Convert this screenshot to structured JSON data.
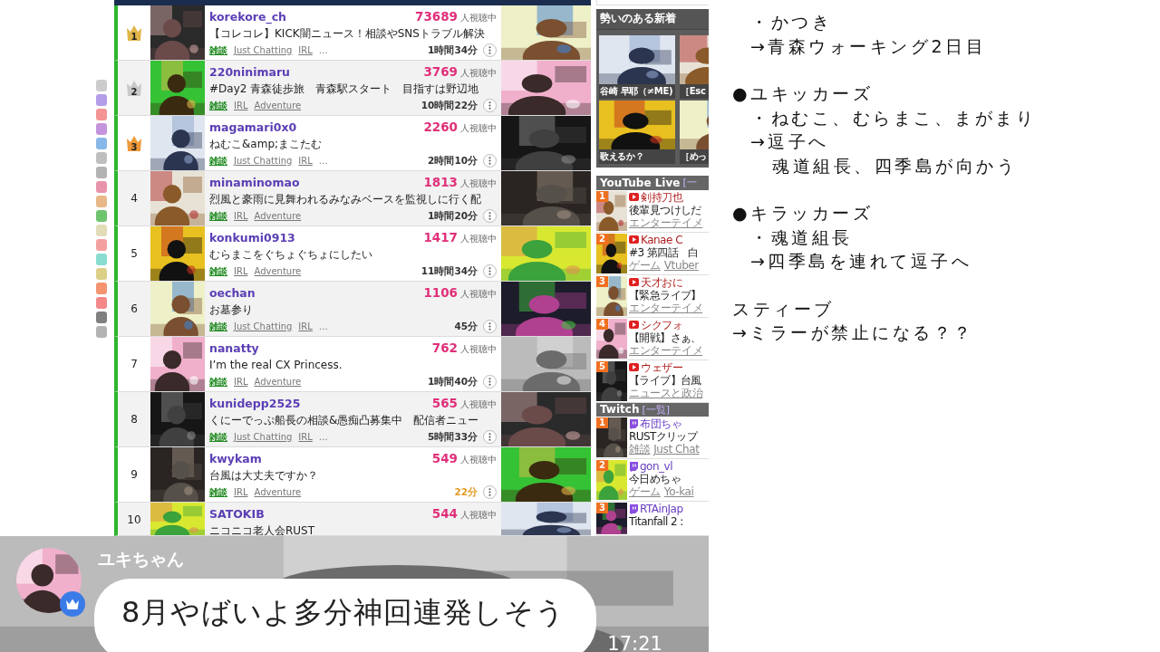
{
  "ranking": {
    "rows": [
      {
        "rank": "1",
        "kind": "crown",
        "color": "#e2b54a",
        "name": "korekore_ch",
        "viewers": "73689",
        "viewers_label": "人視聴中",
        "title": "【コレコレ】KICK闇ニュース！相談やSNSトラブル解決",
        "tags": [
          {
            "label": "雑談",
            "kind": "genre"
          },
          {
            "label": "Just Chatting",
            "kind": "link"
          },
          {
            "label": "IRL",
            "kind": "link"
          },
          {
            "label": "…",
            "kind": "more"
          }
        ],
        "duration": "1時間34分",
        "recent": false
      },
      {
        "rank": "2",
        "kind": "crown",
        "color": "#c9c9c9",
        "name": "220ninimaru",
        "viewers": "3769",
        "viewers_label": "人視聴中",
        "title": "#Day2 青森徒歩旅　青森駅スタート　目指すは野辺地",
        "tags": [
          {
            "label": "雑談",
            "kind": "genre"
          },
          {
            "label": "IRL",
            "kind": "link"
          },
          {
            "label": "Adventure",
            "kind": "link"
          }
        ],
        "duration": "10時間22分",
        "recent": false
      },
      {
        "rank": "3",
        "kind": "crown",
        "color": "#ee9a3a",
        "name": "magamari0x0",
        "viewers": "2260",
        "viewers_label": "人視聴中",
        "title": "ねむこ&amp;まこたむ",
        "tags": [
          {
            "label": "雑談",
            "kind": "genre"
          },
          {
            "label": "Just Chatting",
            "kind": "link"
          },
          {
            "label": "IRL",
            "kind": "link"
          },
          {
            "label": "…",
            "kind": "more"
          }
        ],
        "duration": "2時間10分",
        "recent": false
      },
      {
        "rank": "4",
        "kind": "number",
        "name": "minaminomao",
        "viewers": "1813",
        "viewers_label": "人視聴中",
        "title": "烈風と豪雨に見舞われるみなみベースを監視しに行く配",
        "tags": [
          {
            "label": "雑談",
            "kind": "genre"
          },
          {
            "label": "IRL",
            "kind": "link"
          },
          {
            "label": "Adventure",
            "kind": "link"
          }
        ],
        "duration": "1時間20分",
        "recent": false
      },
      {
        "rank": "5",
        "kind": "number",
        "name": "konkumi0913",
        "viewers": "1417",
        "viewers_label": "人視聴中",
        "title": "むらまこをぐちょぐちょにしたい",
        "tags": [
          {
            "label": "雑談",
            "kind": "genre"
          },
          {
            "label": "IRL",
            "kind": "link"
          },
          {
            "label": "Adventure",
            "kind": "link"
          }
        ],
        "duration": "11時間34分",
        "recent": false
      },
      {
        "rank": "6",
        "kind": "number",
        "name": "oechan",
        "viewers": "1106",
        "viewers_label": "人視聴中",
        "title": "お墓参り",
        "tags": [
          {
            "label": "雑談",
            "kind": "genre"
          },
          {
            "label": "Just Chatting",
            "kind": "link"
          },
          {
            "label": "IRL",
            "kind": "link"
          },
          {
            "label": "…",
            "kind": "more"
          }
        ],
        "duration": "45分",
        "recent": false
      },
      {
        "rank": "7",
        "kind": "number",
        "name": "nanatty",
        "viewers": "762",
        "viewers_label": "人視聴中",
        "title": "I’m the real CX Princess.",
        "tags": [
          {
            "label": "雑談",
            "kind": "genre"
          },
          {
            "label": "IRL",
            "kind": "link"
          },
          {
            "label": "Adventure",
            "kind": "link"
          }
        ],
        "duration": "1時間40分",
        "recent": false
      },
      {
        "rank": "8",
        "kind": "number",
        "name": "kunidepp2525",
        "viewers": "565",
        "viewers_label": "人視聴中",
        "title": "くにーでっぷ船長の相談&愚痴凸募集中　配信者ニュー",
        "tags": [
          {
            "label": "雑談",
            "kind": "genre"
          },
          {
            "label": "Just Chatting",
            "kind": "link"
          },
          {
            "label": "IRL",
            "kind": "link"
          },
          {
            "label": "…",
            "kind": "more"
          }
        ],
        "duration": "5時間33分",
        "recent": false
      },
      {
        "rank": "9",
        "kind": "number",
        "name": "kwykam",
        "viewers": "549",
        "viewers_label": "人視聴中",
        "title": "台風は大丈夫ですか？",
        "tags": [
          {
            "label": "雑談",
            "kind": "genre"
          },
          {
            "label": "IRL",
            "kind": "link"
          },
          {
            "label": "Adventure",
            "kind": "link"
          }
        ],
        "duration": "22分",
        "recent": true
      },
      {
        "rank": "10",
        "kind": "number",
        "name": "SATOKIB",
        "viewers": "544",
        "viewers_label": "人視聴中",
        "title": "ニコニコ老人会RUST"
      }
    ]
  },
  "sidebar": {
    "trending": {
      "title": "勢いのある新着",
      "items": [
        {
          "caption": "谷崎 早耶（≠ME)"
        },
        {
          "caption": "［Esc"
        },
        {
          "caption": "歌えるか？"
        },
        {
          "caption": "［めっ"
        }
      ]
    },
    "youtube": {
      "title": "YouTube Live",
      "link": "[一",
      "items": [
        {
          "rank": "1",
          "title": "剣持刀也",
          "description": "後輩見つけしだ",
          "categories": [
            "エンターテイメ"
          ]
        },
        {
          "rank": "2",
          "title": "Kanae C",
          "description": "#3 第四話　白",
          "categories": [
            "ゲーム",
            "Vtuber"
          ]
        },
        {
          "rank": "3",
          "title": "天才おに",
          "description": "【緊急ライブ】",
          "categories": [
            "エンターテイメ"
          ]
        },
        {
          "rank": "4",
          "title": "シクフォ",
          "description": "【開戦】さぁ、",
          "categories": [
            "エンターテイメ"
          ]
        },
        {
          "rank": "5",
          "title": "ウェザー",
          "description": "【ライブ】台風",
          "categories": [
            "ニュースと政治"
          ]
        }
      ]
    },
    "twitch": {
      "title": "Twitch",
      "link": "[一覧]",
      "items": [
        {
          "rank": "1",
          "title": "布団ちゃ",
          "description": "RUSTクリップ",
          "categories": [
            "雑談",
            "Just Chat"
          ]
        },
        {
          "rank": "2",
          "title": "gon_vl",
          "description": "今日めちゃ",
          "categories": [
            "ゲーム",
            "Yo-kai"
          ]
        },
        {
          "rank": "3",
          "title": "RTAinJap",
          "description": "Titanfall 2 :"
        }
      ]
    }
  },
  "notes": {
    "sections": [
      {
        "lines": [
          {
            "kind": "sub",
            "text": "・かつき"
          },
          {
            "kind": "sub",
            "text": "→青森ウォーキング2日目"
          }
        ]
      },
      {
        "lines": [
          {
            "kind": "head",
            "text": "●ユキッカーズ"
          },
          {
            "kind": "sub",
            "text": "・ねむこ、むらまこ、まがまり"
          },
          {
            "kind": "sub",
            "text": "→逗子へ"
          },
          {
            "kind": "cont",
            "text": "魂道組長、四季島が向かう"
          }
        ]
      },
      {
        "lines": [
          {
            "kind": "head",
            "text": "●キラッカーズ"
          },
          {
            "kind": "sub",
            "text": "・魂道組長"
          },
          {
            "kind": "sub",
            "text": "→四季島を連れて逗子へ"
          }
        ]
      },
      {
        "lines": [
          {
            "kind": "head",
            "text": "スティーブ"
          },
          {
            "kind": "head",
            "text": "→ミラーが禁止になる？？"
          }
        ]
      }
    ]
  },
  "chat": {
    "name": "ユキちゃん",
    "message": "8月やばいよ多分神回連発しそう",
    "time": "17:21"
  }
}
